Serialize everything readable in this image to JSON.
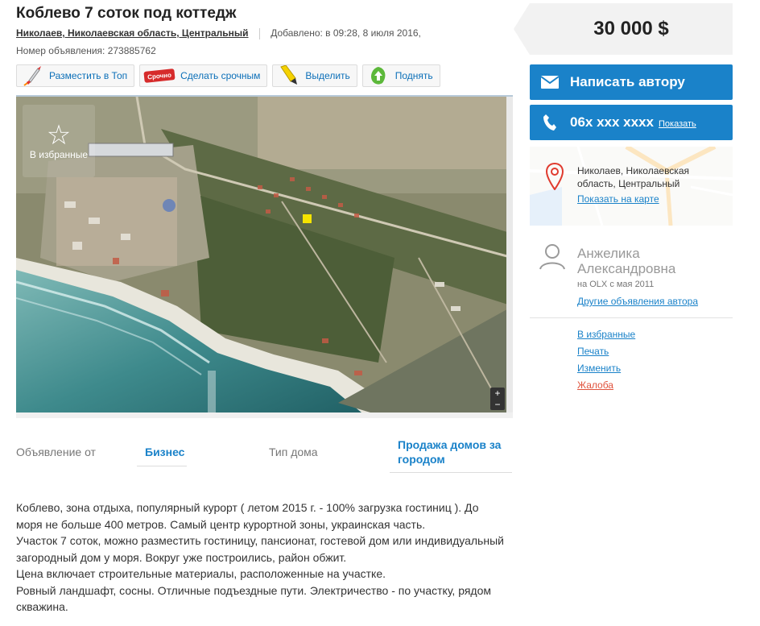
{
  "ad": {
    "title": "Коблево 7 соток под коттедж",
    "location": "Николаев, Николаевская область, Центральный",
    "added": "Добавлено: в 09:28, 8 июля 2016,",
    "ad_id": "Номер объявления: 273885762"
  },
  "actions": [
    {
      "label": "Разместить в Топ",
      "icon": "rocket-icon"
    },
    {
      "label": "Сделать срочным",
      "icon": "urgent-stamp-icon",
      "stamp": "Срочно"
    },
    {
      "label": "Выделить",
      "icon": "highlighter-icon"
    },
    {
      "label": "Поднять",
      "icon": "arrow-up-leaf-icon"
    }
  ],
  "photo": {
    "favorite_label": "В избранные"
  },
  "params": {
    "offer_from_label": "Объявление от",
    "offer_from_value": "Бизнес",
    "house_type_label": "Тип дома",
    "house_type_value": "Продажа домов за городом"
  },
  "description": [
    "Коблево, зона отдыха, популярный курорт ( летом 2015 г. - 100% загрузка гостиниц ). До моря не больше 400 метров. Самый центр курортной зоны, украинская часть.",
    "Участок 7 соток, можно разместить гостиницу, пансионат, гостевой дом или индивидуальный загородный дом у моря. Вокруг уже построились, район обжит.",
    "Цена включает строительные материалы, расположенные на участке.",
    "Ровный ландшафт, сосны. Отличные подъездные пути. Электричество - по участку, рядом скважина."
  ],
  "sidebar": {
    "price": "30 000 $",
    "write_author": "Написать автору",
    "phone": "06x xxx xxxx",
    "show_phone": "Показать",
    "map_location": "Николаев, Николаевская область, Центральный",
    "show_on_map": "Показать на карте",
    "user_name": "Анжелика Александровна",
    "user_since": "на OLX с мая 2011",
    "other_ads": "Другие объявления автора",
    "links": [
      {
        "label": "В избранные",
        "name": "add-to-favorites-link"
      },
      {
        "label": "Печать",
        "name": "print-link"
      },
      {
        "label": "Изменить",
        "name": "edit-link"
      },
      {
        "label": "Жалоба",
        "name": "complaint-link",
        "color": "#e0523c"
      }
    ]
  },
  "colors": {
    "accent": "#1a82c9",
    "price_bg": "#f2f2f2",
    "complaint": "#e0523c"
  }
}
